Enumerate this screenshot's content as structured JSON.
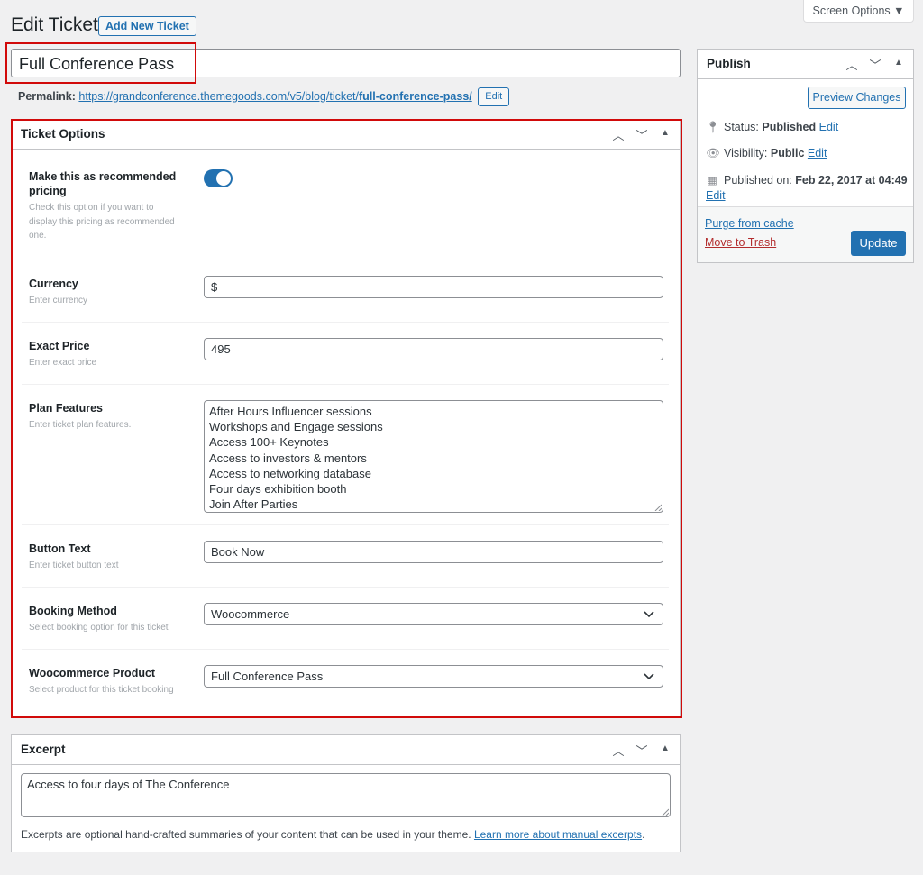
{
  "header": {
    "title": "Edit Ticket",
    "add_new_label": "Add New Ticket",
    "screen_options_label": "Screen Options ▼"
  },
  "post": {
    "title": "Full Conference Pass",
    "permalink_label": "Permalink:",
    "permalink_base": "https://grandconference.themegoods.com/v5/blog/ticket/",
    "permalink_slug": "full-conference-pass/",
    "permalink_edit_label": "Edit"
  },
  "ticket_options": {
    "title": "Ticket Options",
    "recommended": {
      "label": "Make this as recommended pricing",
      "description": "Check this option if you want to display this pricing as recommended one.",
      "enabled": true
    },
    "currency": {
      "label": "Currency",
      "description": "Enter currency",
      "value": "$"
    },
    "exact_price": {
      "label": "Exact Price",
      "description": "Enter exact price",
      "value": "495"
    },
    "plan_features": {
      "label": "Plan Features",
      "description": "Enter ticket plan features.",
      "lines": [
        "After Hours Influencer sessions",
        "Workshops and Engage sessions",
        "Access 100+ Keynotes",
        "Access to investors & mentors",
        "Access to networking database",
        "Four days exhibition booth",
        "Join After Parties"
      ]
    },
    "button_text": {
      "label": "Button Text",
      "description": "Enter ticket button text",
      "value": "Book Now"
    },
    "booking_method": {
      "label": "Booking Method",
      "description": "Select booking option for this ticket",
      "value": "Woocommerce"
    },
    "woo_product": {
      "label": "Woocommerce Product",
      "description": "Select product for this ticket booking",
      "value": "Full Conference Pass"
    }
  },
  "publish": {
    "title": "Publish",
    "preview_label": "Preview Changes",
    "status_label": "Status:",
    "status_value": "Published",
    "visibility_label": "Visibility:",
    "visibility_value": "Public",
    "published_label": "Published on:",
    "published_value": "Feb 22, 2017 at 04:49",
    "edit_label": "Edit",
    "purge_label": "Purge from cache",
    "trash_label": "Move to Trash",
    "update_label": "Update"
  },
  "excerpt": {
    "title": "Excerpt",
    "value": "Access to four days of The Conference",
    "help_text": "Excerpts are optional hand-crafted summaries of your content that can be used in your theme.",
    "help_link": "Learn more about manual excerpts",
    "help_suffix": "."
  },
  "colors": {
    "accent": "#2271b1",
    "highlight_box": "#d10a0a",
    "trash": "#b32d2e"
  }
}
